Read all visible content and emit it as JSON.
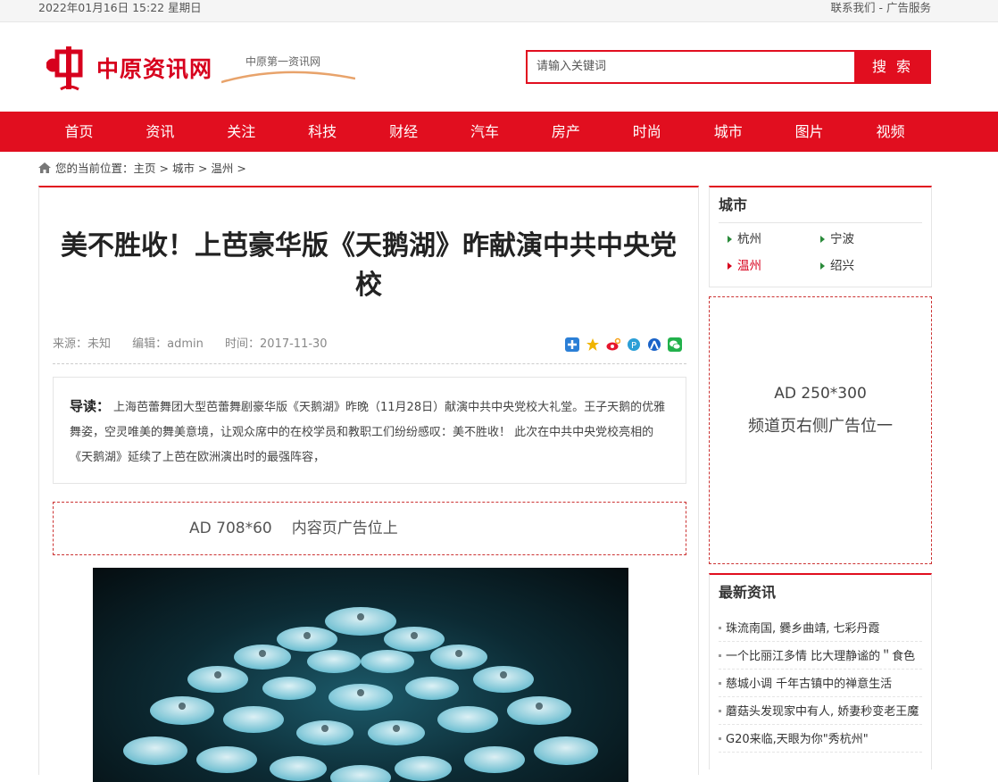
{
  "topbar": {
    "date": "2022年01月16日 15:22 星期日",
    "contact": "联系我们",
    "separator": " - ",
    "ads": "广告服务"
  },
  "logo": {
    "name": "中原资讯网",
    "slogan": "中原第一资讯网"
  },
  "search": {
    "placeholder": "请输入关键词",
    "button": "搜 索"
  },
  "nav": [
    "首页",
    "资讯",
    "关注",
    "科技",
    "财经",
    "汽车",
    "房产",
    "时尚",
    "城市",
    "图片",
    "视频"
  ],
  "breadcrumb": {
    "prefix": "您的当前位置：",
    "items": [
      "主页",
      "城市",
      "温州"
    ],
    "sep": " > "
  },
  "article": {
    "title": "美不胜收！上芭豪华版《天鹅湖》昨献演中共中央党校",
    "source": "来源：未知",
    "editor": "编辑：admin",
    "time": "时间：2017-11-30",
    "lead_label": "导读：",
    "lead": "上海芭蕾舞团大型芭蕾舞剧豪华版《天鹅湖》昨晚（11月28日）献演中共中央党校大礼堂。王子天鹅的优雅舞姿，空灵唯美的舞美意境，让观众席中的在校学员和教职工们纷纷感叹：美不胜收！ 此次在中共中央党校亮相的《天鹅湖》延续了上芭在欧洲演出时的最强阵容，"
  },
  "ad_top": {
    "size": "AD 708*60",
    "label": "内容页广告位上"
  },
  "share_icons": [
    "plus-share-icon",
    "qzone-icon",
    "weibo-icon",
    "pengyou-icon",
    "renren-icon",
    "wechat-icon"
  ],
  "sidebar": {
    "city_title": "城市",
    "cities": [
      {
        "name": "杭州",
        "active": false
      },
      {
        "name": "宁波",
        "active": false
      },
      {
        "name": "温州",
        "active": true
      },
      {
        "name": "绍兴",
        "active": false
      }
    ],
    "ad": {
      "size": "AD 250*300",
      "label": "频道页右侧广告位一"
    },
    "news_title": "最新资讯",
    "news": [
      "珠流南国, 爨乡曲靖, 七彩丹霞",
      "一个比丽江多情 比大理静谧的＂食色",
      "慈城小调 千年古镇中的禅意生活",
      "蘑菇头发现家中有人, 娇妻秒变老王魔",
      "G20来临,天眼为你\"秀杭州\""
    ]
  },
  "colors": {
    "brand_red": "#e10e1f",
    "city_active": "#d7001d"
  }
}
